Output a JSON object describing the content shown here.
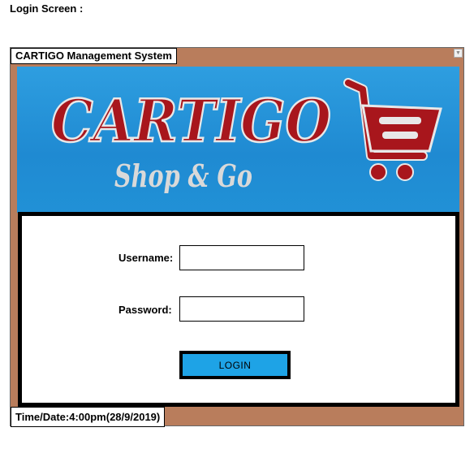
{
  "page": {
    "heading": "Login Screen :"
  },
  "window": {
    "title": "CARTIGO Management System",
    "corner_icon": "chevron-down-icon"
  },
  "banner": {
    "logo_text": "CARTIGO",
    "tagline": "Shop & Go",
    "logo_icon": "shopping-cart-icon",
    "colors": {
      "background": "#2196d8",
      "logo_text": "#a8161c",
      "tagline": "#d9d9d9"
    }
  },
  "form": {
    "username_label": "Username:",
    "username_value": "",
    "password_label": "Password:",
    "password_value": "",
    "login_button": "LOGIN"
  },
  "status": {
    "datetime": "Time/Date:4:00pm(28/9/2019)"
  },
  "colors": {
    "window_background": "#b97d5c",
    "login_button": "#1ea3e6"
  }
}
